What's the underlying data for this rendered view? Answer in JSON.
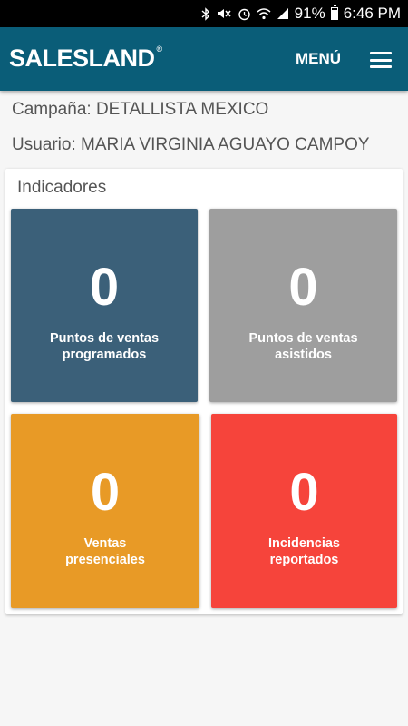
{
  "status_bar": {
    "battery_percent": "91%",
    "time": "6:46 PM",
    "icons": [
      "bluetooth-icon",
      "mute-icon",
      "alarm-icon",
      "wifi-icon",
      "signal-icon",
      "battery-icon"
    ]
  },
  "header": {
    "logo": "SALESLAND",
    "logo_mark": "®",
    "menu_label": "MENÚ",
    "background": "#0a5d78"
  },
  "info": {
    "campaign": "Campaña: DETALLISTA MEXICO",
    "user": "Usuario: MARIA VIRGINIA AGUAYO CAMPOY"
  },
  "indicators": {
    "title": "Indicadores",
    "tiles": [
      {
        "value": "0",
        "line1": "Puntos de ventas",
        "line2": "programados",
        "color": "#3b6079"
      },
      {
        "value": "0",
        "line1": "Puntos de ventas",
        "line2": "asistidos",
        "color": "#9e9e9e"
      },
      {
        "value": "0",
        "line1": "Ventas",
        "line2": "presenciales",
        "color": "#e89a26"
      },
      {
        "value": "0",
        "line1": "Incidencias",
        "line2": "reportados",
        "color": "#f6443b"
      }
    ]
  }
}
